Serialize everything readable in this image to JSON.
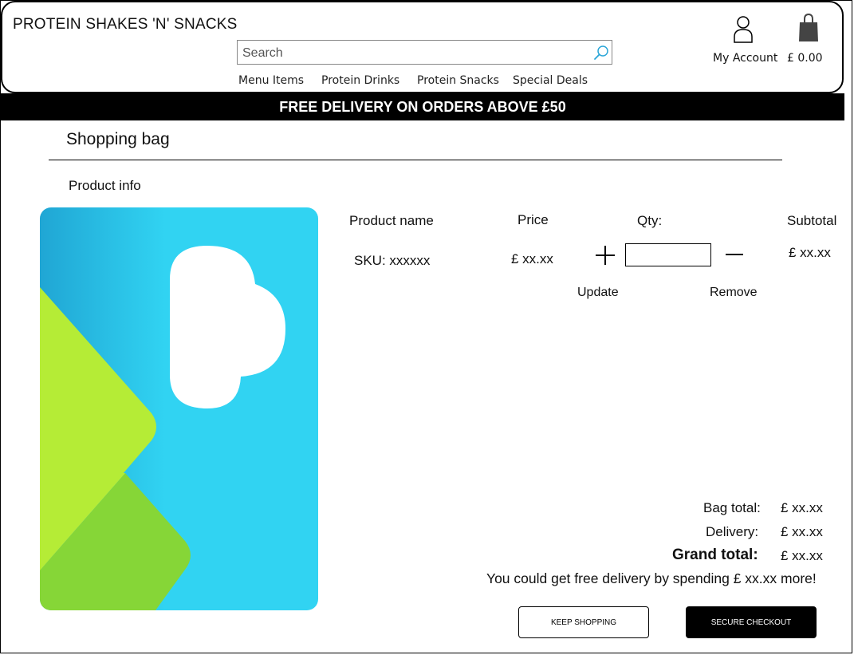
{
  "header": {
    "brand": "PROTEIN SHAKES 'N' SNACKS",
    "search_placeholder": "Search",
    "nav": [
      "Menu Items",
      "Protein Drinks",
      "Protein Snacks",
      "Special Deals"
    ],
    "account_label": "My Account",
    "basket_total": "£ 0.00"
  },
  "banner": "FREE DELIVERY ON ORDERS ABOVE £50",
  "page": {
    "title": "Shopping bag",
    "product_info_label": "Product info"
  },
  "product": {
    "name_label": "Product name",
    "sku": "SKU: xxxxxx",
    "price_header": "Price",
    "price": "£ xx.xx",
    "qty_header": "Qty:",
    "qty_value": "",
    "subtotal_header": "Subtotal",
    "subtotal": "£ xx.xx",
    "update_label": "Update",
    "remove_label": "Remove"
  },
  "totals": {
    "bag_label": "Bag total:",
    "bag_value": "£ xx.xx",
    "delivery_label": "Delivery:",
    "delivery_value": "£ xx.xx",
    "grand_label": "Grand total:",
    "grand_value": "£ xx.xx",
    "promo": "You could get free delivery by spending £ xx.xx more!"
  },
  "buttons": {
    "keep_shopping": "KEEP SHOPPING",
    "checkout": "SECURE CHECKOUT"
  },
  "icons": {
    "search": "search-icon",
    "account": "account-icon",
    "bag": "shopping-bag-icon",
    "plus": "plus-icon",
    "minus": "minus-icon",
    "image": "image-placeholder-icon"
  },
  "colors": {
    "banner_bg": "#000000",
    "image_blue": "#31d3f2",
    "image_green_light": "#b5ec36",
    "image_green": "#86d637"
  }
}
